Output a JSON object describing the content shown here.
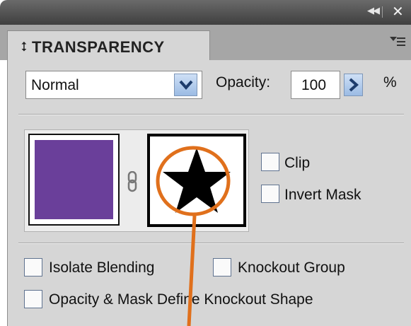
{
  "panel": {
    "title": "TRANSPARENCY",
    "tab_arrows_icon": "⭥",
    "collapse_icon": "◀◀",
    "close_icon": "✕"
  },
  "blend_mode": {
    "selected": "Normal"
  },
  "opacity": {
    "label": "Opacity:",
    "value": "100",
    "unit": "%"
  },
  "thumbnails": {
    "art_fill_color": "#6a3f9a",
    "mask_shape": "star-icon"
  },
  "mask_options": {
    "clip_label": "Clip",
    "invert_mask_label": "Invert Mask"
  },
  "options": {
    "isolate_blending_label": "Isolate Blending",
    "knockout_group_label": "Knockout Group",
    "opacity_mask_label": "Opacity & Mask Define Knockout Shape"
  },
  "colors": {
    "annotation": "#e0701c",
    "titlebar": "#4f4f4f",
    "panel_bg": "#d6d6d6"
  }
}
